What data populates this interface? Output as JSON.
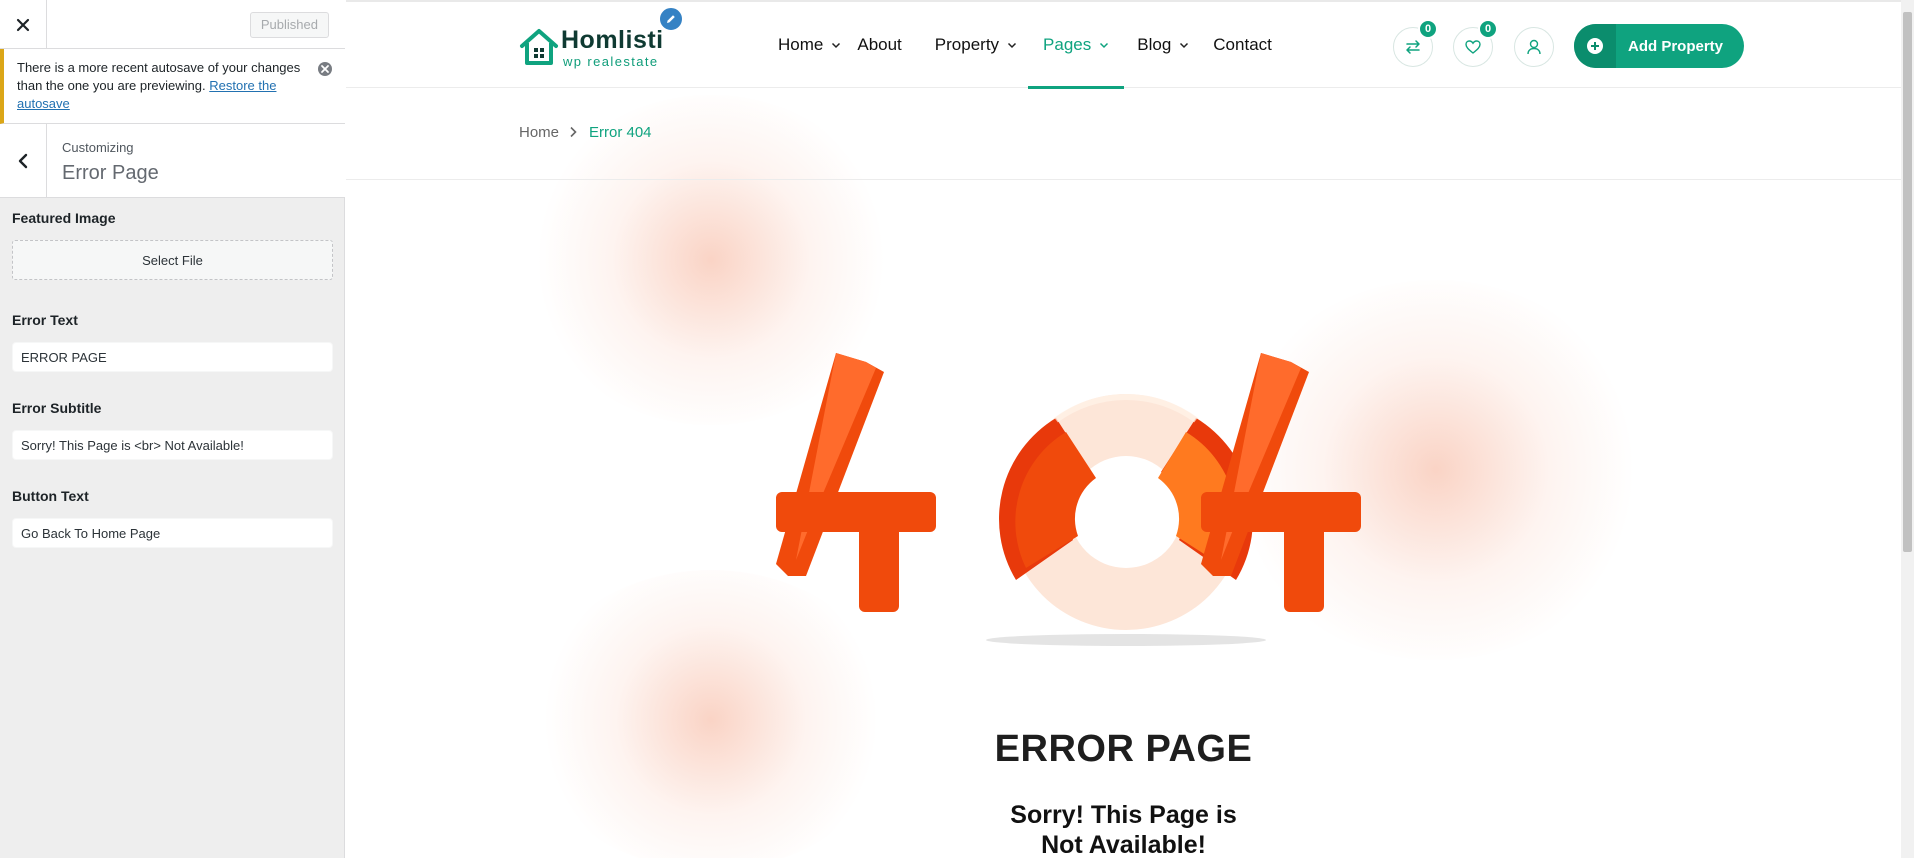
{
  "sidebar": {
    "published_label": "Published",
    "notice": {
      "text": "There is a more recent autosave of your changes than the one you are previewing.",
      "link": "Restore the autosave"
    },
    "section": {
      "crumb": "Customizing",
      "title": "Error Page"
    },
    "controls": {
      "featured_image_label": "Featured Image",
      "select_file_label": "Select File",
      "error_text_label": "Error Text",
      "error_text_value": "ERROR PAGE",
      "error_subtitle_label": "Error Subtitle",
      "error_subtitle_value": "Sorry! This Page is <br> Not Available!",
      "button_text_label": "Button Text",
      "button_text_value": "Go Back To Home Page"
    }
  },
  "preview": {
    "logo": {
      "name": "Homlisti",
      "tagline": "wp realestate"
    },
    "menu": [
      {
        "label": "Home",
        "has_dropdown": true,
        "active": false
      },
      {
        "label": "About",
        "has_dropdown": false,
        "active": false
      },
      {
        "label": "Property",
        "has_dropdown": true,
        "active": false
      },
      {
        "label": "Pages",
        "has_dropdown": true,
        "active": true
      },
      {
        "label": "Blog",
        "has_dropdown": true,
        "active": false
      },
      {
        "label": "Contact",
        "has_dropdown": false,
        "active": false
      }
    ],
    "compare_count": "0",
    "favorites_count": "0",
    "add_property_label": "Add Property",
    "breadcrumb": {
      "home": "Home",
      "current": "Error 404"
    },
    "error": {
      "code": "404",
      "title": "ERROR PAGE",
      "subtitle_line1": "Sorry! This Page is",
      "subtitle_line2": "Not Available!"
    }
  },
  "colors": {
    "accent": "#0fa37f",
    "error_orange": "#f04a0c",
    "notice_border": "#dba617",
    "link": "#2271b1"
  }
}
